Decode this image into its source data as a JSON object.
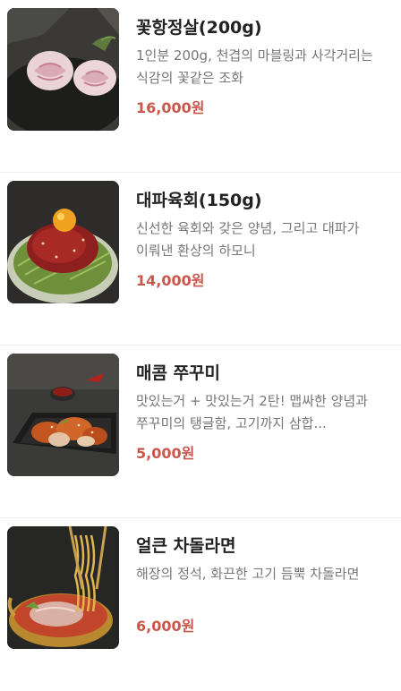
{
  "menu": {
    "items": [
      {
        "name": "꽃항정살(200g)",
        "description": "1인분 200g, 천겹의 마블링과 사각거리는 식감의 꽃같은 조화",
        "price": "16,000원",
        "image_icon": "pork-jowl-rolls-photo"
      },
      {
        "name": "대파육회(150g)",
        "description": "신선한 육회와 갖은 양념, 그리고 대파가 이뤄낸 환상의 하모니",
        "price": "14,000원",
        "image_icon": "beef-tartare-egg-photo"
      },
      {
        "name": "매콤 쭈꾸미",
        "description": "맛있는거 + 맛있는거 2탄! 맵싸한 양념과 쭈꾸미의 탱글함, 고기까지 삼합...",
        "price": "5,000원",
        "image_icon": "spicy-webfoot-octopus-photo"
      },
      {
        "name": "얼큰 차돌라면",
        "description": "해장의 정석, 화끈한 고기 듬뿍 차돌라면",
        "price": "6,000원",
        "image_icon": "brisket-ramen-pot-photo"
      }
    ]
  },
  "colors": {
    "price": "#c9574c",
    "name": "#222222",
    "description": "#777777",
    "divider": "#ececec"
  }
}
